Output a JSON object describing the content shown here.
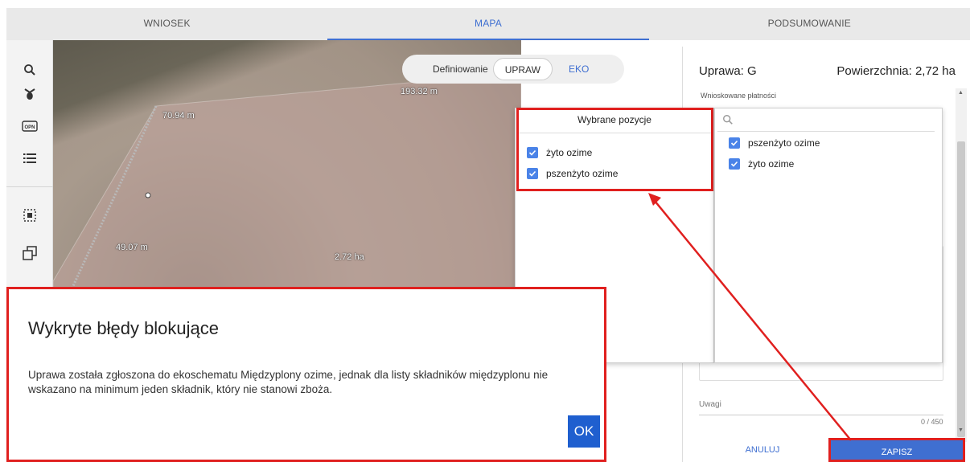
{
  "tabs": [
    {
      "label": "WNIOSEK"
    },
    {
      "label": "MAPA"
    },
    {
      "label": "PODSUMOWANIE"
    }
  ],
  "toolbar": {
    "icons": [
      "search-icon",
      "layers-icon",
      "opn-icon",
      "list-icon",
      "select-area-icon",
      "copy-icon"
    ],
    "opn_text": "OPN"
  },
  "map": {
    "watermark": "ocean",
    "labels": {
      "top": "193.32 m",
      "left_top": "70.94 m",
      "left_bottom": "49.07 m",
      "area": "2.72 ha"
    }
  },
  "toggle": {
    "label": "Definiowanie",
    "option_on": "UPRAW",
    "option_off": "EKO"
  },
  "form": {
    "title": "Uprawa: G",
    "area": "Powierzchnia: 2,72 ha",
    "payments_label": "Wnioskowane płatności",
    "remarks_label": "Uwagi",
    "counter": "0 / 450",
    "cancel_label": "ANULUJ",
    "save_label": "ZAPISZ"
  },
  "selected_panel": {
    "header": "Wybrane pozycje",
    "items": [
      "żyto ozime",
      "pszenżyto ozime"
    ]
  },
  "options_panel": {
    "items": [
      "pszenżyto ozime",
      "żyto ozime"
    ]
  },
  "dialog": {
    "title": "Wykryte błędy blokujące",
    "body": "Uprawa została zgłoszona do ekoschematu Międzyplony ozime, jednak dla listy składników międzyplonu nie wskazano na minimum jeden składnik, który nie stanowi zboża.",
    "ok_label": "OK"
  },
  "colors": {
    "accent": "#3f6fd1",
    "highlight": "#e0201f",
    "checkbox": "#4a83e8",
    "ok_button": "#1f5fcf"
  }
}
